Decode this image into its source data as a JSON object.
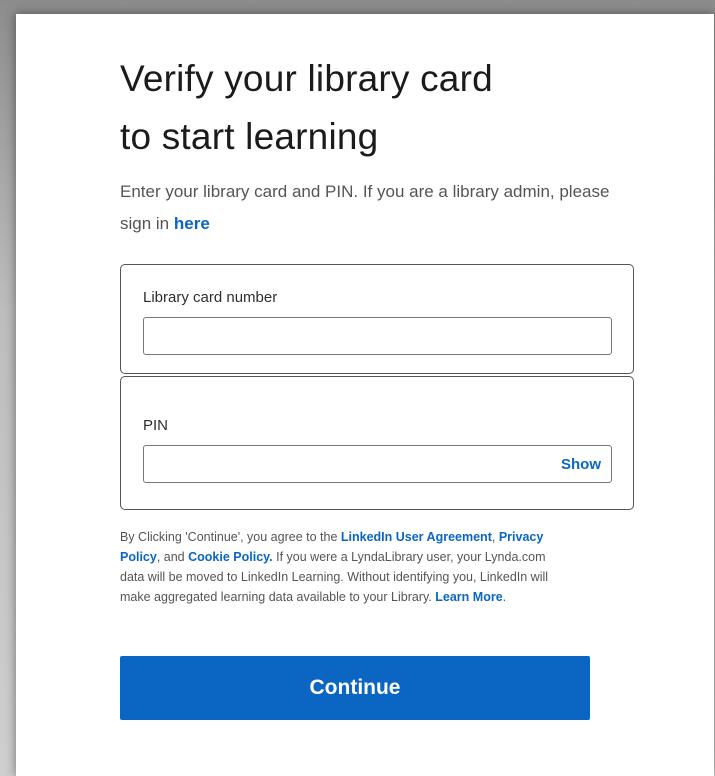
{
  "header": {
    "title_line1": "Verify your library card",
    "title_line2": "to start learning",
    "subtitle": "Enter your library card and PIN. If you are a library admin, please sign in",
    "subtitle_link": "here"
  },
  "form": {
    "card_label": "Library card number",
    "card_value": "",
    "card_placeholder": "",
    "pin_label": "PIN",
    "pin_value": "",
    "pin_placeholder": "",
    "show_label": "Show"
  },
  "legal": {
    "text1": "By Clicking 'Continue', you agree to the",
    "link_user_agreement": "LinkedIn User Agreement",
    "text2": ",",
    "link_privacy": "Privacy Policy",
    "text3": ", and",
    "link_cookie": "Cookie Policy.",
    "text4": "If you were a LyndaLibrary user, your Lynda.com data will be moved to LinkedIn Learning. Without identifying you, LinkedIn will make aggregated learning data available to your Library.",
    "link_learn_more": "Learn More",
    "text5": "."
  },
  "actions": {
    "continue_label": "Continue"
  },
  "colors": {
    "accent": "#0a66c2",
    "text": "#1b1b1b",
    "muted": "#555555"
  }
}
